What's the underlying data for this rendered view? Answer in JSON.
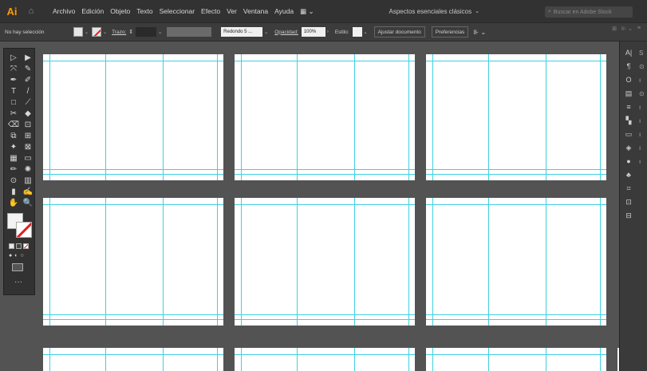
{
  "app": {
    "logo": "Ai",
    "home_icon": "home-icon"
  },
  "menu": [
    "Archivo",
    "Edición",
    "Objeto",
    "Texto",
    "Seleccionar",
    "Efecto",
    "Ver",
    "Ventana",
    "Ayuda"
  ],
  "workspace": {
    "label": "Aspectos esenciales clásicos",
    "chevron": "⌄"
  },
  "search": {
    "placeholder": "Buscar en Adobe Stock",
    "icon": "search-icon"
  },
  "controlbar": {
    "selection_label": "No hay selección",
    "stroke_label": "Trazo:",
    "brush_value": "Redondo 5 ...",
    "opacity_label": "Opacidad:",
    "opacity_value": "100%",
    "style_label": "Estilo:",
    "ajustar_label": "Ajustar documento",
    "preferencias_label": "Preferencias"
  },
  "colors": {
    "accent": "#ff9a00",
    "guide": "#3fd0e0",
    "stroke_none": "#e02020",
    "canvas": "#535353"
  },
  "tools": [
    "▷",
    "▶",
    "⤧",
    "✎",
    "✒",
    "✐",
    "T",
    "/",
    "□",
    "⟋",
    "✂",
    "◆",
    "⌫",
    "⊡",
    "⧉",
    "⊞",
    "✦",
    "⊠",
    "▦",
    "▭",
    "✏",
    "✺",
    "⊙",
    "▥",
    "▮",
    "✍",
    "✋",
    "🔍"
  ],
  "dock_icons": [
    "A|",
    "¶",
    "O",
    "▤",
    "≡",
    "▚",
    "▭",
    "◈",
    "●",
    "♣",
    "⌗",
    "⊡",
    "⊟"
  ],
  "dock_icons2": [
    "S",
    "⊙",
    "ı",
    "⊙",
    "ı",
    "ı",
    "ı",
    "ı",
    "ı"
  ],
  "more_tools": "···"
}
